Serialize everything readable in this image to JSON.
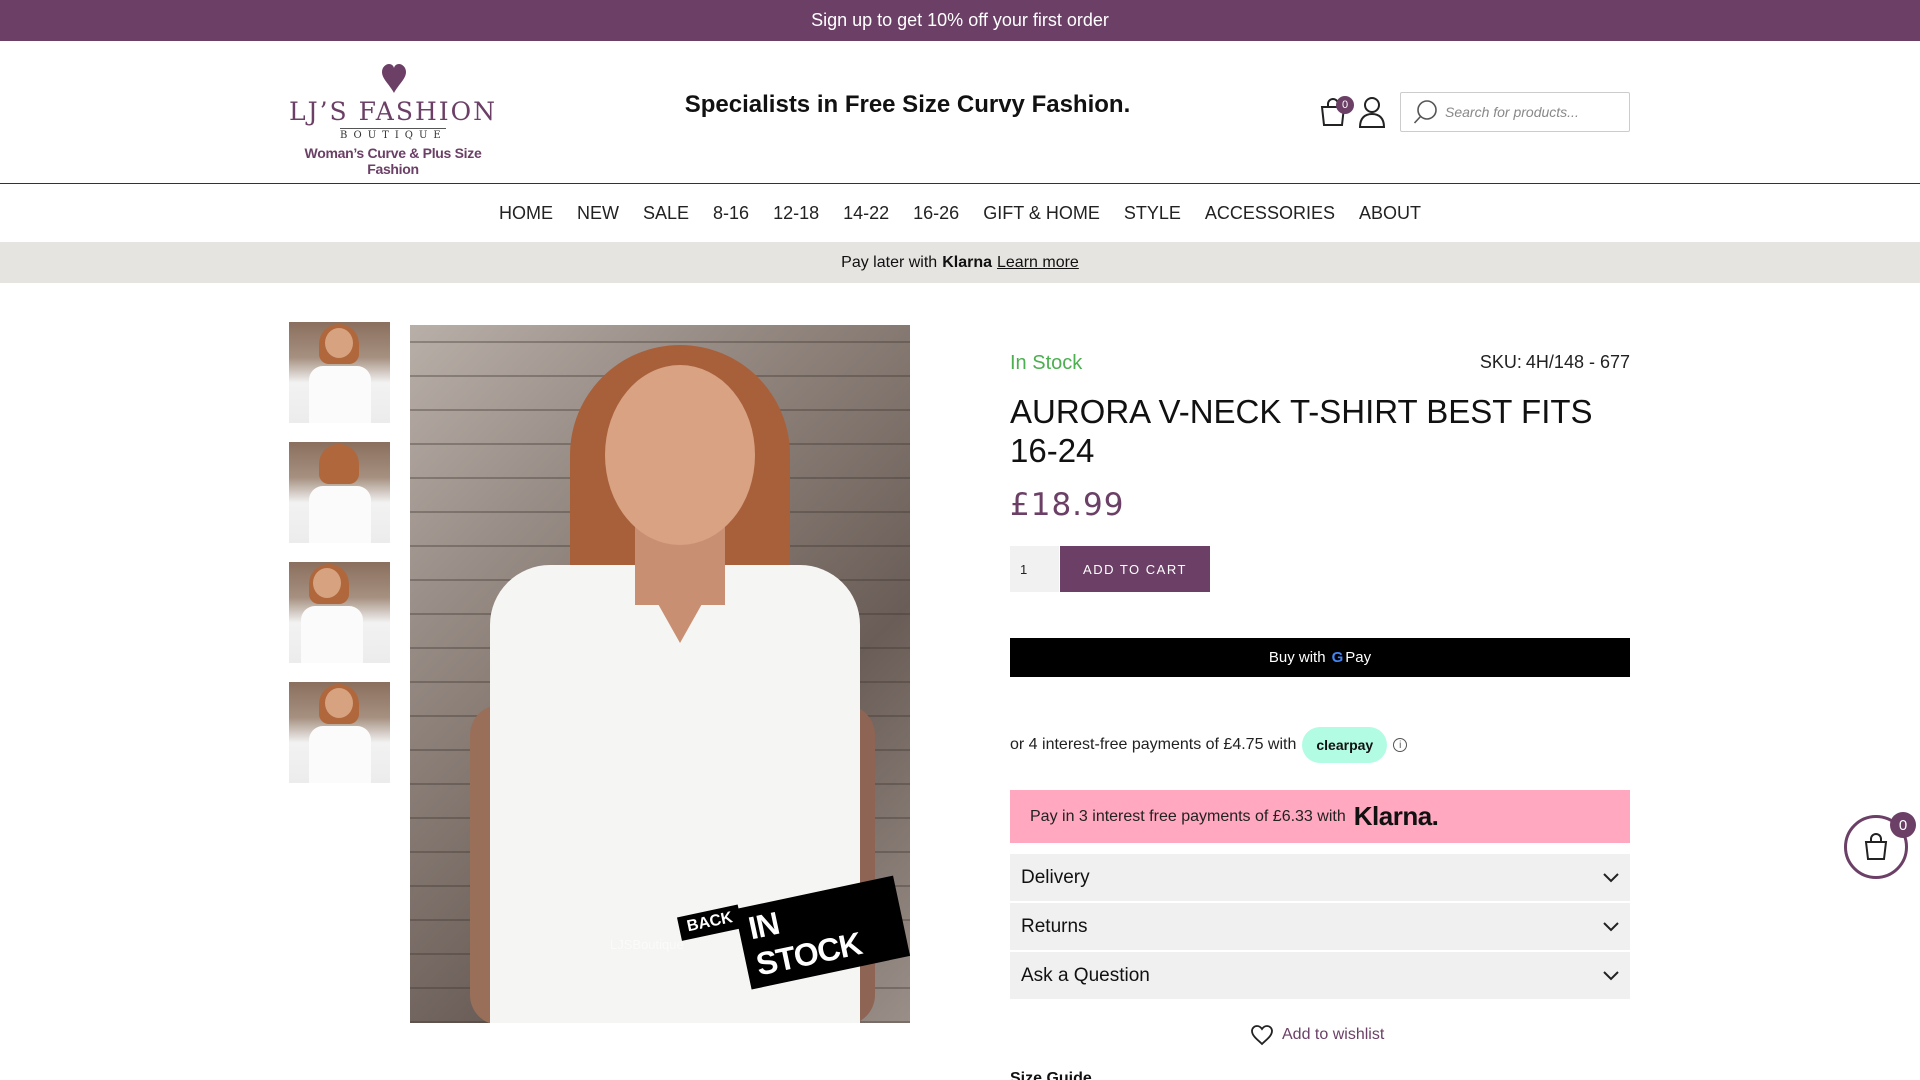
{
  "promo": {
    "text": "Sign up to get 10% off your first order"
  },
  "header": {
    "logo": {
      "name": "LJ’S FASHION",
      "sub": "BOUTIQUE",
      "tagline": "Woman’s Curve & Plus Size Fashion"
    },
    "tagline": "Specialists in Free Size Curvy Fashion.",
    "cart_count": "0",
    "search_placeholder": "Search for products..."
  },
  "nav": {
    "items": [
      "HOME",
      "NEW",
      "SALE",
      "8-16",
      "12-18",
      "14-22",
      "16-26",
      "GIFT & HOME",
      "STYLE",
      "ACCESSORIES",
      "ABOUT"
    ]
  },
  "klarna_bar": {
    "prefix": "Pay later with",
    "logo": "Klarna",
    "link": "Learn more"
  },
  "gallery": {
    "thumb_count": 4,
    "sticker_back": "BACK",
    "sticker_main": "IN STOCK",
    "watermark": "LJSBoutique"
  },
  "product": {
    "stock": "In Stock",
    "sku_label": "SKU:",
    "sku": "4H/148 - 677",
    "title": "AURORA V-NECK T-SHIRT BEST FITS 16-24",
    "price": "£18.99",
    "qty": "1",
    "add_to_cart": "ADD TO CART",
    "gpay": {
      "prefix": "Buy with",
      "g": "G",
      "pay": "Pay"
    },
    "clearpay": {
      "text": "or 4 interest-free payments of £4.75 with",
      "badge": "clearpay",
      "info": "i"
    },
    "klarna": {
      "text": "Pay in 3 interest free payments of £6.33 with",
      "logo": "Klarna."
    },
    "accordions": {
      "delivery": "Delivery",
      "returns": "Returns",
      "question": "Ask a Question"
    },
    "wishlist": "Add to wishlist",
    "cut_heading": "Size Guide"
  },
  "floating_cart": {
    "count": "0"
  },
  "colors": {
    "brand": "#6b3f66",
    "stock": "#4caf50",
    "klarna_pink": "#ffa8c0",
    "clearpay_mint": "#b2fce4"
  },
  "icons": [
    "heart-logo-icon",
    "cart-icon",
    "account-icon",
    "search-icon",
    "chevron-down-icon",
    "heart-icon",
    "bag-icon"
  ]
}
